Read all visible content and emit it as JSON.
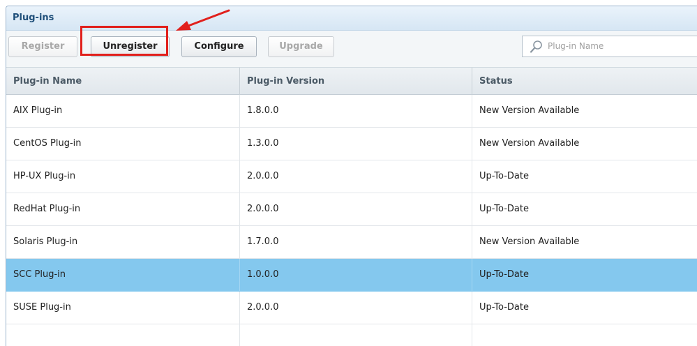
{
  "panel": {
    "title": "Plug-ins"
  },
  "toolbar": {
    "register_label": "Register",
    "unregister_label": "Unregister",
    "configure_label": "Configure",
    "upgrade_label": "Upgrade"
  },
  "search": {
    "placeholder": "Plug-in Name",
    "value": ""
  },
  "table": {
    "columns": [
      "Plug-in Name",
      "Plug-in Version",
      "Status"
    ],
    "rows": [
      {
        "name": "AIX Plug-in",
        "version": "1.8.0.0",
        "status": "New Version Available",
        "selected": false
      },
      {
        "name": "CentOS Plug-in",
        "version": "1.3.0.0",
        "status": "New Version Available",
        "selected": false
      },
      {
        "name": "HP-UX Plug-in",
        "version": "2.0.0.0",
        "status": "Up-To-Date",
        "selected": false
      },
      {
        "name": "RedHat Plug-in",
        "version": "2.0.0.0",
        "status": "Up-To-Date",
        "selected": false
      },
      {
        "name": "Solaris Plug-in",
        "version": "1.7.0.0",
        "status": "New Version Available",
        "selected": false
      },
      {
        "name": "SCC Plug-in",
        "version": "1.0.0.0",
        "status": "Up-To-Date",
        "selected": true
      },
      {
        "name": "SUSE Plug-in",
        "version": "2.0.0.0",
        "status": "Up-To-Date",
        "selected": false
      }
    ]
  },
  "icons": {
    "search": "search-icon",
    "annotation_arrow": "arrow-icon"
  },
  "colors": {
    "title_text": "#1f4f7a",
    "selected_row": "#84c8ee",
    "annotation_red": "#e1201c"
  }
}
